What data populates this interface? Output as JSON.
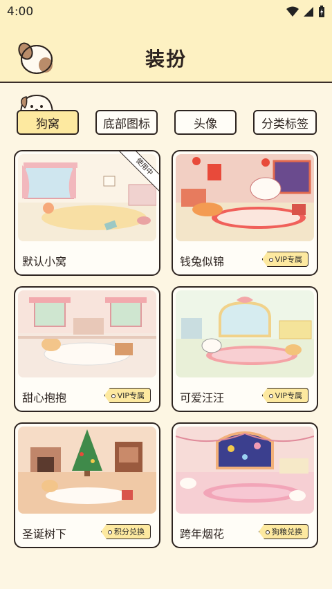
{
  "status_bar": {
    "time": "4:00"
  },
  "header": {
    "title": "装扮"
  },
  "tabs": [
    {
      "label": "狗窝",
      "active": true
    },
    {
      "label": "底部图标",
      "active": false
    },
    {
      "label": "头像",
      "active": false
    },
    {
      "label": "分类标签",
      "active": false
    }
  ],
  "items": [
    {
      "name": "默认小窝",
      "badge": "",
      "ribbon": "使用中",
      "scene": "default"
    },
    {
      "name": "钱兔似锦",
      "badge": "VIP专属",
      "ribbon": "",
      "scene": "rabbit"
    },
    {
      "name": "甜心抱抱",
      "badge": "VIP专属",
      "ribbon": "",
      "scene": "sweet"
    },
    {
      "name": "可爱汪汪",
      "badge": "VIP专属",
      "ribbon": "",
      "scene": "cute"
    },
    {
      "name": "圣诞树下",
      "badge": "积分兑换",
      "ribbon": "",
      "scene": "christmas"
    },
    {
      "name": "跨年烟花",
      "badge": "狗粮兑换",
      "ribbon": "",
      "scene": "fireworks"
    }
  ],
  "colors": {
    "header_bg": "#fdf1c2",
    "page_bg": "#fdf6e3",
    "tab_active": "#fde9a0",
    "badge_bg": "#fde9a0",
    "outline": "#2d2420"
  }
}
